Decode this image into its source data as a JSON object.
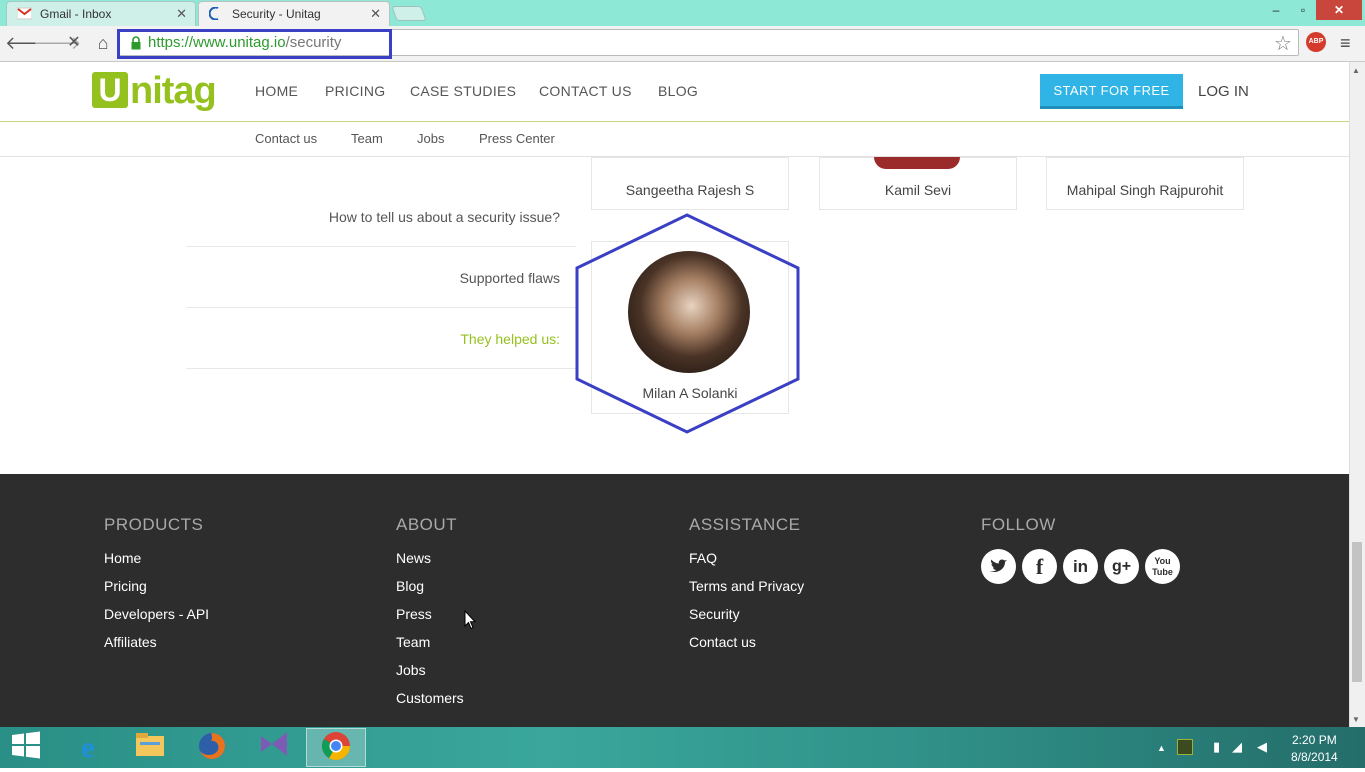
{
  "browser": {
    "tabs": [
      {
        "title": "Gmail - Inbox",
        "icon": "gmail-icon"
      },
      {
        "title": "Security - Unitag",
        "icon": "loading-spinner-icon"
      }
    ],
    "url_domain": "https://www.unitag.io",
    "url_path": "/security",
    "window_controls": {
      "minimize": "–",
      "maximize": "▫",
      "close": "✕"
    },
    "abp_label": "ABP"
  },
  "site": {
    "logo_letter": "U",
    "logo_rest": "nitag",
    "nav": [
      "HOME",
      "PRICING",
      "CASE STUDIES",
      "CONTACT US",
      "BLOG"
    ],
    "cta": "START FOR FREE",
    "login": "LOG IN",
    "subnav": [
      "Contact us",
      "Team",
      "Jobs",
      "Press Center"
    ],
    "side_menu": [
      "How to tell us about a security issue?",
      "Supported flaws",
      "They helped us:"
    ],
    "people": [
      "Sangeetha Rajesh S",
      "Kamil Sevi",
      "Mahipal Singh Rajpurohit",
      "Milan A Solanki"
    ],
    "accent_color": "#95c11f",
    "cta_color": "#2fb4e5",
    "highlight_color": "#3a3fc4"
  },
  "footer": {
    "products": {
      "title": "PRODUCTS",
      "links": [
        "Home",
        "Pricing",
        "Developers - API",
        "Affiliates"
      ]
    },
    "about": {
      "title": "ABOUT",
      "links": [
        "News",
        "Blog",
        "Press",
        "Team",
        "Jobs",
        "Customers"
      ]
    },
    "assistance": {
      "title": "ASSISTANCE",
      "links": [
        "FAQ",
        "Terms and Privacy",
        "Security",
        "Contact us"
      ]
    },
    "follow": {
      "title": "FOLLOW",
      "icons": [
        "twitter-icon",
        "facebook-icon",
        "linkedin-icon",
        "google-plus-icon",
        "youtube-icon"
      ]
    }
  },
  "taskbar": {
    "apps": [
      "internet-explorer-icon",
      "file-explorer-icon",
      "firefox-icon",
      "visual-studio-icon",
      "chrome-icon"
    ],
    "time": "2:20 PM",
    "date": "8/8/2014"
  }
}
